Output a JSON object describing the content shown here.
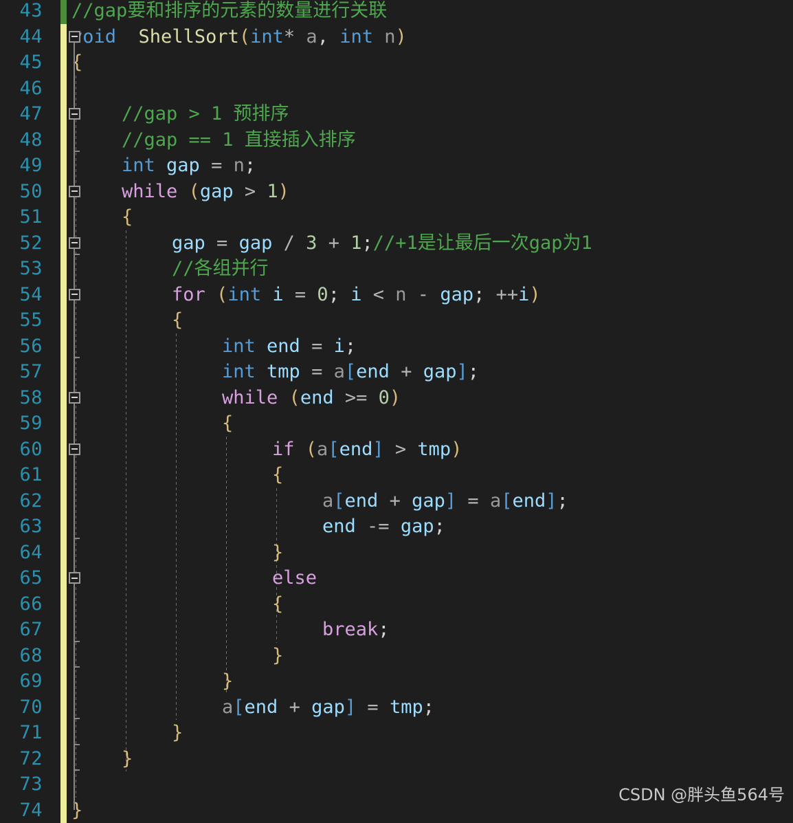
{
  "editor": {
    "theme_name": "dark",
    "colors": {
      "background": "#1E1E1E",
      "line_number": "#2B91AF",
      "comment": "#4EA64E",
      "keyword": "#569CD6",
      "control_keyword": "#D8A0DF",
      "function": "#DCDCAA",
      "variable": "#9CDCFE",
      "number": "#B5CEA8",
      "brace": "#D7BA7D",
      "changebar_saved": "#4B8B3B",
      "changebar_unsaved": "#EDED9C",
      "fold_marker": "#9A9A9A",
      "indent_guide": "#6E6E6E",
      "watermark": "#C8C8C8"
    },
    "first_line": 43,
    "last_line": 74,
    "line_height": 37.5,
    "tab_width": 4
  },
  "line_numbers": [
    "43",
    "44",
    "45",
    "46",
    "47",
    "48",
    "49",
    "50",
    "51",
    "52",
    "53",
    "54",
    "55",
    "56",
    "57",
    "58",
    "59",
    "60",
    "61",
    "62",
    "63",
    "64",
    "65",
    "66",
    "67",
    "68",
    "69",
    "70",
    "71",
    "72",
    "73",
    "74"
  ],
  "change_bar": [
    {
      "line": 43,
      "state": "saved"
    },
    {
      "line": 44,
      "state": "unsaved"
    },
    {
      "line": 45,
      "state": "unsaved"
    },
    {
      "line": 46,
      "state": "unsaved"
    },
    {
      "line": 47,
      "state": "unsaved"
    },
    {
      "line": 48,
      "state": "unsaved"
    },
    {
      "line": 49,
      "state": "unsaved"
    },
    {
      "line": 50,
      "state": "unsaved"
    },
    {
      "line": 51,
      "state": "unsaved"
    },
    {
      "line": 52,
      "state": "unsaved"
    },
    {
      "line": 53,
      "state": "unsaved"
    },
    {
      "line": 54,
      "state": "unsaved"
    },
    {
      "line": 55,
      "state": "unsaved"
    },
    {
      "line": 56,
      "state": "unsaved"
    },
    {
      "line": 57,
      "state": "unsaved"
    },
    {
      "line": 58,
      "state": "unsaved"
    },
    {
      "line": 59,
      "state": "unsaved"
    },
    {
      "line": 60,
      "state": "unsaved"
    },
    {
      "line": 61,
      "state": "unsaved"
    },
    {
      "line": 62,
      "state": "unsaved"
    },
    {
      "line": 63,
      "state": "unsaved"
    },
    {
      "line": 64,
      "state": "unsaved"
    },
    {
      "line": 65,
      "state": "unsaved"
    },
    {
      "line": 66,
      "state": "unsaved"
    },
    {
      "line": 67,
      "state": "unsaved"
    },
    {
      "line": 68,
      "state": "unsaved"
    },
    {
      "line": 69,
      "state": "unsaved"
    },
    {
      "line": 70,
      "state": "unsaved"
    },
    {
      "line": 71,
      "state": "unsaved"
    },
    {
      "line": 72,
      "state": "unsaved"
    },
    {
      "line": 73,
      "state": "unsaved"
    },
    {
      "line": 74,
      "state": "unsaved"
    }
  ],
  "fold_markers": [
    {
      "line": 44,
      "state": "expanded",
      "glyph": "minus-box"
    },
    {
      "line": 47,
      "state": "expanded",
      "glyph": "minus-box"
    },
    {
      "line": 50,
      "state": "expanded",
      "glyph": "minus-box"
    },
    {
      "line": 52,
      "state": "expanded",
      "glyph": "minus-box"
    },
    {
      "line": 54,
      "state": "expanded",
      "glyph": "minus-box"
    },
    {
      "line": 58,
      "state": "expanded",
      "glyph": "minus-box"
    },
    {
      "line": 60,
      "state": "expanded",
      "glyph": "minus-box"
    },
    {
      "line": 65,
      "state": "expanded",
      "glyph": "minus-box"
    }
  ],
  "code_lines": [
    {
      "n": 43,
      "indent": 0,
      "text": "//gap要和排序的元素的数量进行关联",
      "tokens": [
        {
          "t": "//gap要和排序的元素的数量进行关联",
          "c": "cmt"
        }
      ]
    },
    {
      "n": 44,
      "indent": 0,
      "text": "void  ShellSort(int* a, int n)",
      "tokens": [
        {
          "t": "void",
          "c": "kw"
        },
        {
          "t": "  ",
          "c": "punct"
        },
        {
          "t": "ShellSort",
          "c": "fn"
        },
        {
          "t": "(",
          "c": "paren"
        },
        {
          "t": "int",
          "c": "kw"
        },
        {
          "t": "* ",
          "c": "op"
        },
        {
          "t": "a",
          "c": "param"
        },
        {
          "t": ", ",
          "c": "punct"
        },
        {
          "t": "int",
          "c": "kw"
        },
        {
          "t": " ",
          "c": "punct"
        },
        {
          "t": "n",
          "c": "param"
        },
        {
          "t": ")",
          "c": "paren"
        }
      ]
    },
    {
      "n": 45,
      "indent": 0,
      "text": "{",
      "tokens": [
        {
          "t": "{",
          "c": "brace"
        }
      ]
    },
    {
      "n": 46,
      "indent": 0,
      "text": "",
      "tokens": []
    },
    {
      "n": 47,
      "indent": 1,
      "text": "//gap > 1 预排序",
      "tokens": [
        {
          "t": "//gap > 1 预排序",
          "c": "cmt"
        }
      ]
    },
    {
      "n": 48,
      "indent": 1,
      "text": "//gap == 1 直接插入排序",
      "tokens": [
        {
          "t": "//gap == 1 直接插入排序",
          "c": "cmt"
        }
      ]
    },
    {
      "n": 49,
      "indent": 1,
      "text": "int gap = n;",
      "tokens": [
        {
          "t": "int",
          "c": "kw"
        },
        {
          "t": " ",
          "c": "punct"
        },
        {
          "t": "gap",
          "c": "var"
        },
        {
          "t": " ",
          "c": "punct"
        },
        {
          "t": "=",
          "c": "op"
        },
        {
          "t": " ",
          "c": "punct"
        },
        {
          "t": "n",
          "c": "param"
        },
        {
          "t": ";",
          "c": "punct"
        }
      ]
    },
    {
      "n": 50,
      "indent": 1,
      "text": "while (gap > 1)",
      "tokens": [
        {
          "t": "while",
          "c": "ctrl"
        },
        {
          "t": " ",
          "c": "punct"
        },
        {
          "t": "(",
          "c": "paren"
        },
        {
          "t": "gap",
          "c": "var"
        },
        {
          "t": " ",
          "c": "punct"
        },
        {
          "t": ">",
          "c": "op"
        },
        {
          "t": " ",
          "c": "punct"
        },
        {
          "t": "1",
          "c": "num"
        },
        {
          "t": ")",
          "c": "paren"
        }
      ]
    },
    {
      "n": 51,
      "indent": 1,
      "text": "{",
      "tokens": [
        {
          "t": "{",
          "c": "brace"
        }
      ]
    },
    {
      "n": 52,
      "indent": 2,
      "text": "gap = gap / 3 + 1;//+1是让最后一次gap为1",
      "tokens": [
        {
          "t": "gap",
          "c": "var"
        },
        {
          "t": " ",
          "c": "punct"
        },
        {
          "t": "=",
          "c": "op"
        },
        {
          "t": " ",
          "c": "punct"
        },
        {
          "t": "gap",
          "c": "var"
        },
        {
          "t": " ",
          "c": "punct"
        },
        {
          "t": "/",
          "c": "op"
        },
        {
          "t": " ",
          "c": "punct"
        },
        {
          "t": "3",
          "c": "num"
        },
        {
          "t": " ",
          "c": "punct"
        },
        {
          "t": "+",
          "c": "op"
        },
        {
          "t": " ",
          "c": "punct"
        },
        {
          "t": "1",
          "c": "num"
        },
        {
          "t": ";",
          "c": "punct"
        },
        {
          "t": "//+1是让最后一次gap为1",
          "c": "cmt"
        }
      ]
    },
    {
      "n": 53,
      "indent": 2,
      "text": "//各组并行",
      "tokens": [
        {
          "t": "//各组并行",
          "c": "cmt"
        }
      ]
    },
    {
      "n": 54,
      "indent": 2,
      "text": "for (int i = 0; i < n - gap; ++i)",
      "tokens": [
        {
          "t": "for",
          "c": "ctrl"
        },
        {
          "t": " ",
          "c": "punct"
        },
        {
          "t": "(",
          "c": "paren"
        },
        {
          "t": "int",
          "c": "kw"
        },
        {
          "t": " ",
          "c": "punct"
        },
        {
          "t": "i",
          "c": "var"
        },
        {
          "t": " ",
          "c": "punct"
        },
        {
          "t": "=",
          "c": "op"
        },
        {
          "t": " ",
          "c": "punct"
        },
        {
          "t": "0",
          "c": "num"
        },
        {
          "t": "; ",
          "c": "punct"
        },
        {
          "t": "i",
          "c": "var"
        },
        {
          "t": " ",
          "c": "punct"
        },
        {
          "t": "<",
          "c": "op"
        },
        {
          "t": " ",
          "c": "punct"
        },
        {
          "t": "n",
          "c": "param"
        },
        {
          "t": " ",
          "c": "punct"
        },
        {
          "t": "-",
          "c": "op"
        },
        {
          "t": " ",
          "c": "punct"
        },
        {
          "t": "gap",
          "c": "var"
        },
        {
          "t": "; ",
          "c": "punct"
        },
        {
          "t": "++",
          "c": "op"
        },
        {
          "t": "i",
          "c": "var"
        },
        {
          "t": ")",
          "c": "paren"
        }
      ]
    },
    {
      "n": 55,
      "indent": 2,
      "text": "{",
      "tokens": [
        {
          "t": "{",
          "c": "brace"
        }
      ]
    },
    {
      "n": 56,
      "indent": 3,
      "text": "int end = i;",
      "tokens": [
        {
          "t": "int",
          "c": "kw"
        },
        {
          "t": " ",
          "c": "punct"
        },
        {
          "t": "end",
          "c": "var"
        },
        {
          "t": " ",
          "c": "punct"
        },
        {
          "t": "=",
          "c": "op"
        },
        {
          "t": " ",
          "c": "punct"
        },
        {
          "t": "i",
          "c": "var"
        },
        {
          "t": ";",
          "c": "punct"
        }
      ]
    },
    {
      "n": 57,
      "indent": 3,
      "text": "int tmp = a[end + gap];",
      "tokens": [
        {
          "t": "int",
          "c": "kw"
        },
        {
          "t": " ",
          "c": "punct"
        },
        {
          "t": "tmp",
          "c": "var"
        },
        {
          "t": " ",
          "c": "punct"
        },
        {
          "t": "=",
          "c": "op"
        },
        {
          "t": " ",
          "c": "punct"
        },
        {
          "t": "a",
          "c": "param"
        },
        {
          "t": "[",
          "c": "brack"
        },
        {
          "t": "end",
          "c": "var"
        },
        {
          "t": " ",
          "c": "punct"
        },
        {
          "t": "+",
          "c": "op"
        },
        {
          "t": " ",
          "c": "punct"
        },
        {
          "t": "gap",
          "c": "var"
        },
        {
          "t": "]",
          "c": "brack"
        },
        {
          "t": ";",
          "c": "punct"
        }
      ]
    },
    {
      "n": 58,
      "indent": 3,
      "text": "while (end >= 0)",
      "tokens": [
        {
          "t": "while",
          "c": "ctrl"
        },
        {
          "t": " ",
          "c": "punct"
        },
        {
          "t": "(",
          "c": "paren"
        },
        {
          "t": "end",
          "c": "var"
        },
        {
          "t": " ",
          "c": "punct"
        },
        {
          "t": ">=",
          "c": "op"
        },
        {
          "t": " ",
          "c": "punct"
        },
        {
          "t": "0",
          "c": "num"
        },
        {
          "t": ")",
          "c": "paren"
        }
      ]
    },
    {
      "n": 59,
      "indent": 3,
      "text": "{",
      "tokens": [
        {
          "t": "{",
          "c": "brace"
        }
      ]
    },
    {
      "n": 60,
      "indent": 4,
      "text": "if (a[end] > tmp)",
      "tokens": [
        {
          "t": "if",
          "c": "ctrl"
        },
        {
          "t": " ",
          "c": "punct"
        },
        {
          "t": "(",
          "c": "paren"
        },
        {
          "t": "a",
          "c": "param"
        },
        {
          "t": "[",
          "c": "brack"
        },
        {
          "t": "end",
          "c": "var"
        },
        {
          "t": "]",
          "c": "brack"
        },
        {
          "t": " ",
          "c": "punct"
        },
        {
          "t": ">",
          "c": "op"
        },
        {
          "t": " ",
          "c": "punct"
        },
        {
          "t": "tmp",
          "c": "var"
        },
        {
          "t": ")",
          "c": "paren"
        }
      ]
    },
    {
      "n": 61,
      "indent": 4,
      "text": "{",
      "tokens": [
        {
          "t": "{",
          "c": "brace"
        }
      ]
    },
    {
      "n": 62,
      "indent": 5,
      "text": "a[end + gap] = a[end];",
      "tokens": [
        {
          "t": "a",
          "c": "param"
        },
        {
          "t": "[",
          "c": "brack"
        },
        {
          "t": "end",
          "c": "var"
        },
        {
          "t": " ",
          "c": "punct"
        },
        {
          "t": "+",
          "c": "op"
        },
        {
          "t": " ",
          "c": "punct"
        },
        {
          "t": "gap",
          "c": "var"
        },
        {
          "t": "]",
          "c": "brack"
        },
        {
          "t": " ",
          "c": "punct"
        },
        {
          "t": "=",
          "c": "op"
        },
        {
          "t": " ",
          "c": "punct"
        },
        {
          "t": "a",
          "c": "param"
        },
        {
          "t": "[",
          "c": "brack"
        },
        {
          "t": "end",
          "c": "var"
        },
        {
          "t": "]",
          "c": "brack"
        },
        {
          "t": ";",
          "c": "punct"
        }
      ]
    },
    {
      "n": 63,
      "indent": 5,
      "text": "end -= gap;",
      "tokens": [
        {
          "t": "end",
          "c": "var"
        },
        {
          "t": " ",
          "c": "punct"
        },
        {
          "t": "-=",
          "c": "op"
        },
        {
          "t": " ",
          "c": "punct"
        },
        {
          "t": "gap",
          "c": "var"
        },
        {
          "t": ";",
          "c": "punct"
        }
      ]
    },
    {
      "n": 64,
      "indent": 4,
      "text": "}",
      "tokens": [
        {
          "t": "}",
          "c": "brace"
        }
      ]
    },
    {
      "n": 65,
      "indent": 4,
      "text": "else",
      "tokens": [
        {
          "t": "else",
          "c": "ctrl"
        }
      ]
    },
    {
      "n": 66,
      "indent": 4,
      "text": "{",
      "tokens": [
        {
          "t": "{",
          "c": "brace"
        }
      ]
    },
    {
      "n": 67,
      "indent": 5,
      "text": "break;",
      "tokens": [
        {
          "t": "break",
          "c": "ctrl"
        },
        {
          "t": ";",
          "c": "punct"
        }
      ]
    },
    {
      "n": 68,
      "indent": 4,
      "text": "}",
      "tokens": [
        {
          "t": "}",
          "c": "brace"
        }
      ]
    },
    {
      "n": 69,
      "indent": 3,
      "text": "}",
      "tokens": [
        {
          "t": "}",
          "c": "brace"
        }
      ]
    },
    {
      "n": 70,
      "indent": 3,
      "text": "a[end + gap] = tmp;",
      "tokens": [
        {
          "t": "a",
          "c": "param"
        },
        {
          "t": "[",
          "c": "brack"
        },
        {
          "t": "end",
          "c": "var"
        },
        {
          "t": " ",
          "c": "punct"
        },
        {
          "t": "+",
          "c": "op"
        },
        {
          "t": " ",
          "c": "punct"
        },
        {
          "t": "gap",
          "c": "var"
        },
        {
          "t": "]",
          "c": "brack"
        },
        {
          "t": " ",
          "c": "punct"
        },
        {
          "t": "=",
          "c": "op"
        },
        {
          "t": " ",
          "c": "punct"
        },
        {
          "t": "tmp",
          "c": "var"
        },
        {
          "t": ";",
          "c": "punct"
        }
      ]
    },
    {
      "n": 71,
      "indent": 2,
      "text": "}",
      "tokens": [
        {
          "t": "}",
          "c": "brace"
        }
      ]
    },
    {
      "n": 72,
      "indent": 1,
      "text": "}",
      "tokens": [
        {
          "t": "}",
          "c": "brace"
        }
      ]
    },
    {
      "n": 73,
      "indent": 0,
      "text": "",
      "tokens": []
    },
    {
      "n": 74,
      "indent": 0,
      "text": "}",
      "tokens": [
        {
          "t": "}",
          "c": "brace"
        }
      ]
    }
  ],
  "indent_guides": [
    {
      "level": 1,
      "from_line": 46,
      "to_line": 73
    },
    {
      "level": 2,
      "from_line": 52,
      "to_line": 72
    },
    {
      "level": 3,
      "from_line": 56,
      "to_line": 70
    },
    {
      "level": 4,
      "from_line": 60,
      "to_line": 69
    },
    {
      "level": 5,
      "from_line": 62,
      "to_line": 67
    }
  ],
  "watermark": {
    "text": "CSDN @胖头鱼564号"
  }
}
